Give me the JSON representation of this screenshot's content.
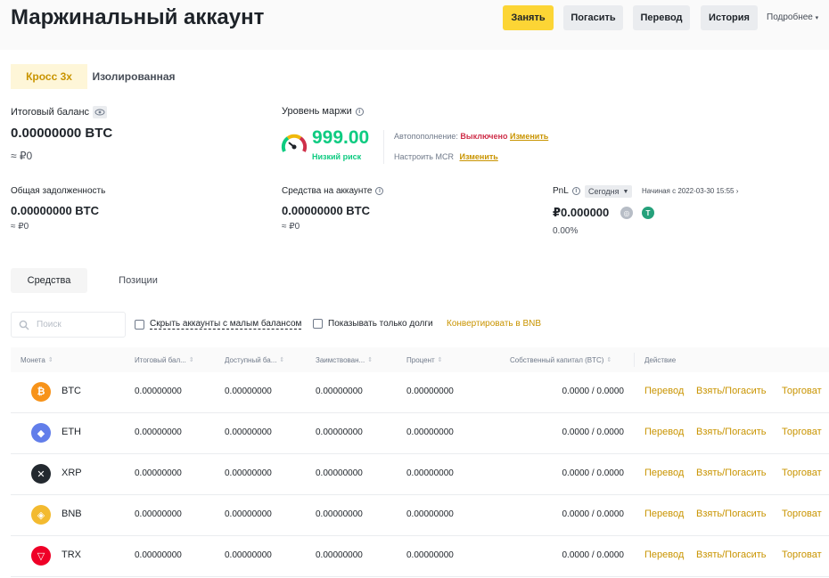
{
  "header": {
    "title": "Маржинальный аккаунт",
    "buttons": {
      "borrow": "Занять",
      "repay": "Погасить",
      "transfer": "Перевод",
      "history": "История"
    },
    "more": "Подробнее"
  },
  "mode_tabs": [
    "Кросс 3x",
    "Изолированная"
  ],
  "summary": {
    "total_balance_label": "Итоговый баланс",
    "total_balance": "0.00000000 BTC",
    "total_balance_fiat": "≈ ₽0",
    "margin_level_label": "Уровень маржи",
    "margin_level": "999.00",
    "risk_label": "Низкий риск",
    "auto_topup_label": "Автопополнение:",
    "auto_topup_value": "Выключено",
    "change": "Изменить",
    "mcr_label": "Настроить MCR",
    "total_debt_label": "Общая задолженность",
    "total_debt": "0.00000000 BTC",
    "total_debt_fiat": "≈ ₽0",
    "account_equity_label": "Средства на аккаунте",
    "account_equity": "0.00000000 BTC",
    "account_equity_fiat": "≈ ₽0",
    "pnl_label": "PnL",
    "pnl_period": "Сегодня",
    "pnl_since": "Начиная с 2022-03-30 15:55",
    "pnl_value": "₽0.000000",
    "pnl_percent": "0.00%"
  },
  "section_tabs": [
    "Средства",
    "Позиции"
  ],
  "filters": {
    "search_placeholder": "Поиск",
    "hide_small": "Скрыть аккаунты с малым балансом",
    "only_debts": "Показывать только долги",
    "convert": "Конвертировать в BNB"
  },
  "table": {
    "columns": [
      "Монета",
      "Итоговый бал...",
      "Доступный ба...",
      "Заимствован...",
      "Процент",
      "Собственный капитал (BTC)",
      "Действие"
    ],
    "actions": [
      "Перевод",
      "Взять/Погасить",
      "Торговат"
    ],
    "rows": [
      {
        "coin": "BTC",
        "icon": "bitcoin-icon",
        "color": "#f7931a",
        "total": "0.00000000",
        "available": "0.00000000",
        "borrowed": "0.00000000",
        "interest": "0.00000000",
        "equity": "0.0000 / 0.0000"
      },
      {
        "coin": "ETH",
        "icon": "ethereum-icon",
        "color": "#627eea",
        "total": "0.00000000",
        "available": "0.00000000",
        "borrowed": "0.00000000",
        "interest": "0.00000000",
        "equity": "0.0000 / 0.0000"
      },
      {
        "coin": "XRP",
        "icon": "xrp-icon",
        "color": "#23292f",
        "total": "0.00000000",
        "available": "0.00000000",
        "borrowed": "0.00000000",
        "interest": "0.00000000",
        "equity": "0.0000 / 0.0000"
      },
      {
        "coin": "BNB",
        "icon": "bnb-icon",
        "color": "#f3ba2f",
        "total": "0.00000000",
        "available": "0.00000000",
        "borrowed": "0.00000000",
        "interest": "0.00000000",
        "equity": "0.0000 / 0.0000"
      },
      {
        "coin": "TRX",
        "icon": "tron-icon",
        "color": "#ef0027",
        "total": "0.00000000",
        "available": "0.00000000",
        "borrowed": "0.00000000",
        "interest": "0.00000000",
        "equity": "0.0000 / 0.0000"
      }
    ]
  },
  "colors": {
    "accent": "#fcd535",
    "link": "#c99400",
    "positive": "#0ecb81",
    "negative": "#cf304a"
  }
}
